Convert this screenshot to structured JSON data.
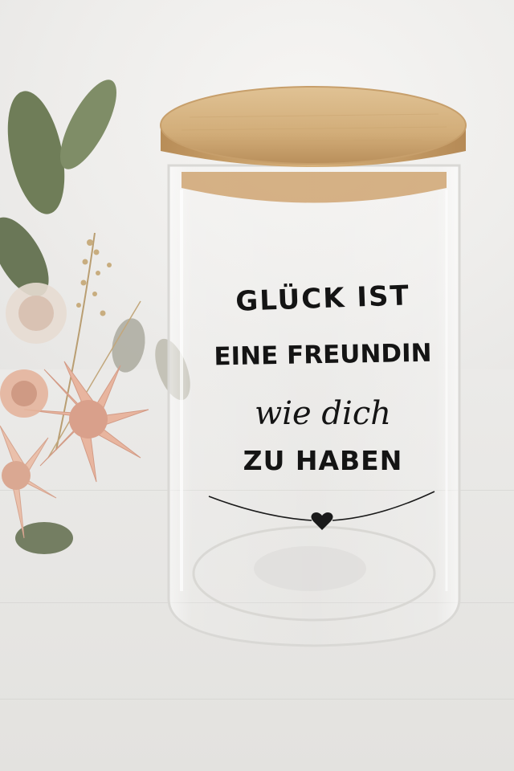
{
  "jar_label": {
    "line1": "GLÜCK IST",
    "line2": "EINE FREUNDIN",
    "line3": "wie dich",
    "line4": "ZU HABEN"
  },
  "colors": {
    "background": "#efeeec",
    "lid_wood": "#d9b886",
    "text": "#141414",
    "flower_pink": "#e9b9a4",
    "leaf_green": "#7d8a63"
  },
  "icons": {
    "divider_heart": "heart-icon"
  }
}
